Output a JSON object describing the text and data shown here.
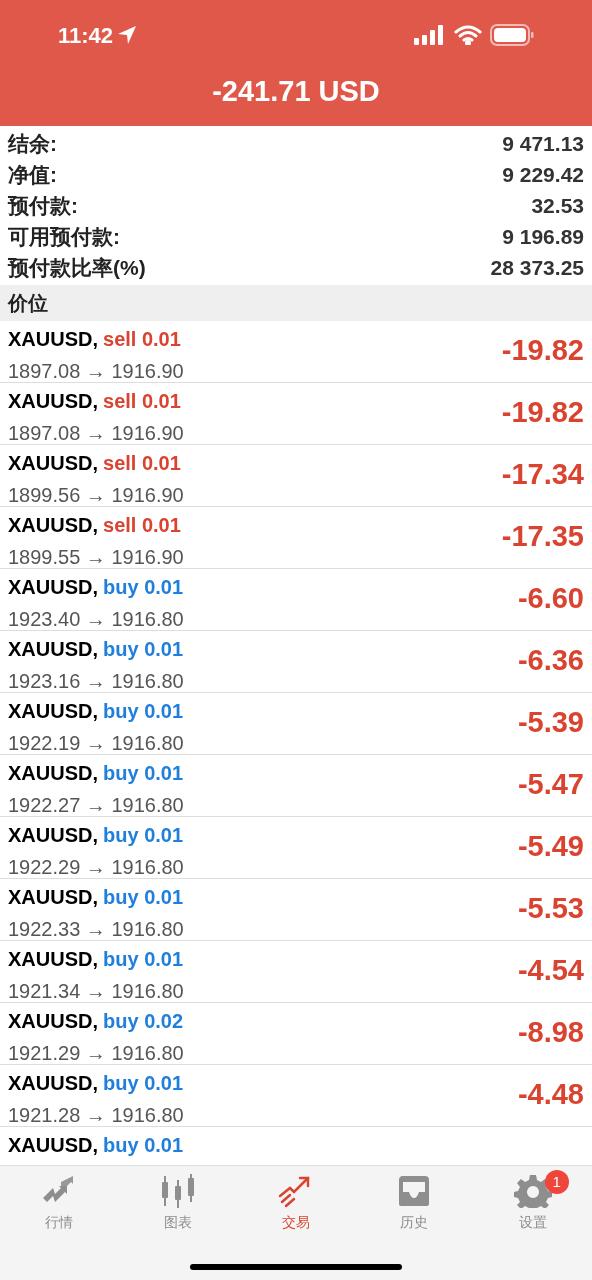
{
  "status_bar": {
    "time": "11:42"
  },
  "header": {
    "title": "-241.71 USD"
  },
  "summary": [
    {
      "label": "结余:",
      "value": "9 471.13"
    },
    {
      "label": "净值:",
      "value": "9 229.42"
    },
    {
      "label": "预付款:",
      "value": "32.53"
    },
    {
      "label": "可用预付款:",
      "value": "9 196.89"
    },
    {
      "label": "预付款比率(%)",
      "value": "28 373.25"
    }
  ],
  "section_title": "价位",
  "positions": [
    {
      "symbol": "XAUUSD,",
      "kind": "sell",
      "order": "sell 0.01",
      "prices": "1897.08 → 1916.90",
      "profit": "-19.82"
    },
    {
      "symbol": "XAUUSD,",
      "kind": "sell",
      "order": "sell 0.01",
      "prices": "1897.08 → 1916.90",
      "profit": "-19.82"
    },
    {
      "symbol": "XAUUSD,",
      "kind": "sell",
      "order": "sell 0.01",
      "prices": "1899.56 → 1916.90",
      "profit": "-17.34"
    },
    {
      "symbol": "XAUUSD,",
      "kind": "sell",
      "order": "sell 0.01",
      "prices": "1899.55 → 1916.90",
      "profit": "-17.35"
    },
    {
      "symbol": "XAUUSD,",
      "kind": "buy",
      "order": "buy 0.01",
      "prices": "1923.40 → 1916.80",
      "profit": "-6.60"
    },
    {
      "symbol": "XAUUSD,",
      "kind": "buy",
      "order": "buy 0.01",
      "prices": "1923.16 → 1916.80",
      "profit": "-6.36"
    },
    {
      "symbol": "XAUUSD,",
      "kind": "buy",
      "order": "buy 0.01",
      "prices": "1922.19 → 1916.80",
      "profit": "-5.39"
    },
    {
      "symbol": "XAUUSD,",
      "kind": "buy",
      "order": "buy 0.01",
      "prices": "1922.27 → 1916.80",
      "profit": "-5.47"
    },
    {
      "symbol": "XAUUSD,",
      "kind": "buy",
      "order": "buy 0.01",
      "prices": "1922.29 → 1916.80",
      "profit": "-5.49"
    },
    {
      "symbol": "XAUUSD,",
      "kind": "buy",
      "order": "buy 0.01",
      "prices": "1922.33 → 1916.80",
      "profit": "-5.53"
    },
    {
      "symbol": "XAUUSD,",
      "kind": "buy",
      "order": "buy 0.01",
      "prices": "1921.34 → 1916.80",
      "profit": "-4.54"
    },
    {
      "symbol": "XAUUSD,",
      "kind": "buy",
      "order": "buy 0.02",
      "prices": "1921.29 → 1916.80",
      "profit": "-8.98"
    },
    {
      "symbol": "XAUUSD,",
      "kind": "buy",
      "order": "buy 0.01",
      "prices": "1921.28 → 1916.80",
      "profit": "-4.48"
    },
    {
      "symbol": "XAUUSD,",
      "kind": "buy",
      "order": "buy 0.01"
    }
  ],
  "tabs": [
    {
      "label": "行情",
      "selected": false
    },
    {
      "label": "图表",
      "selected": false
    },
    {
      "label": "交易",
      "selected": true
    },
    {
      "label": "历史",
      "selected": false
    },
    {
      "label": "设置",
      "selected": false,
      "badge": "1"
    }
  ]
}
